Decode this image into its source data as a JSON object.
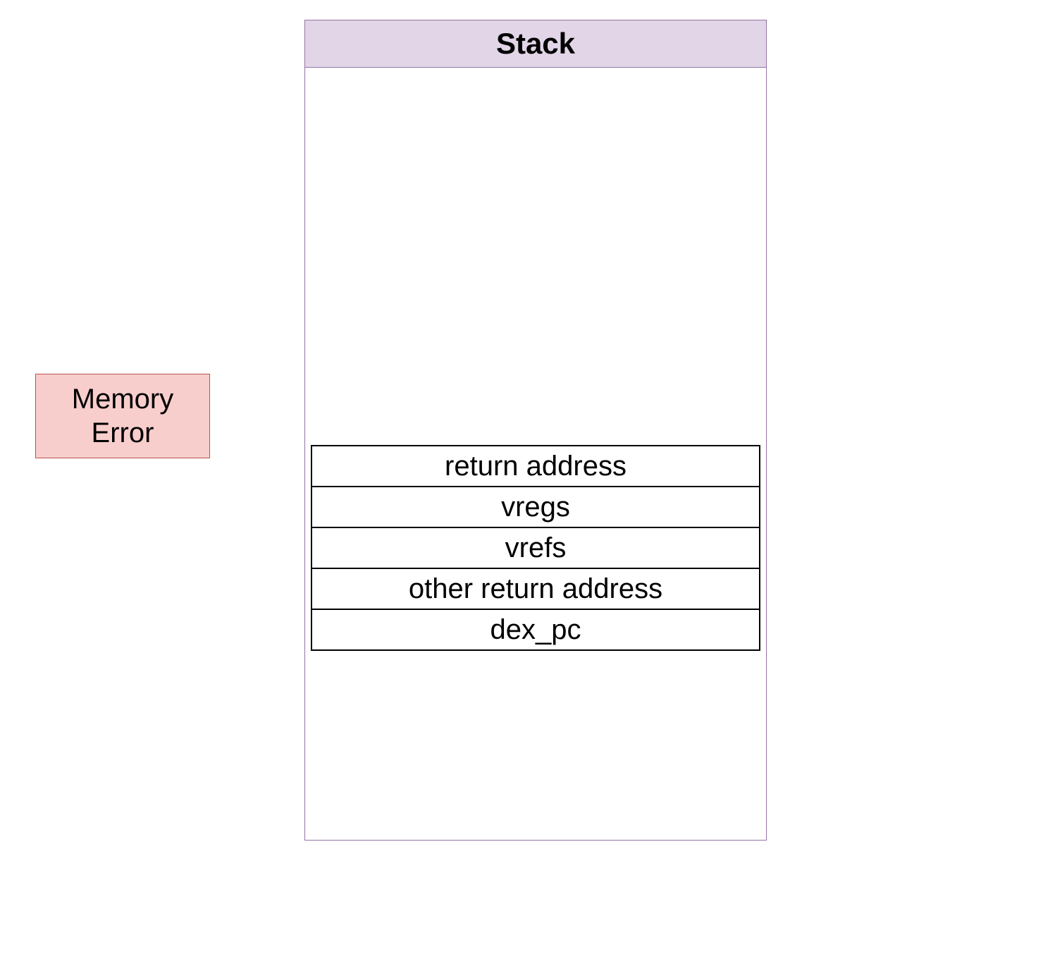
{
  "memory_error": {
    "label": "Memory\nError"
  },
  "stack": {
    "title": "Stack",
    "rows": [
      {
        "label": "return address"
      },
      {
        "label": "vregs"
      },
      {
        "label": "vrefs"
      },
      {
        "label": "other return address"
      },
      {
        "label": "dex_pc"
      }
    ]
  },
  "colors": {
    "memory_error_bg": "#f8cecc",
    "memory_error_border": "#b85450",
    "stack_header_bg": "#e1d5e7",
    "stack_border": "#9673a6",
    "row_border": "#000000"
  }
}
